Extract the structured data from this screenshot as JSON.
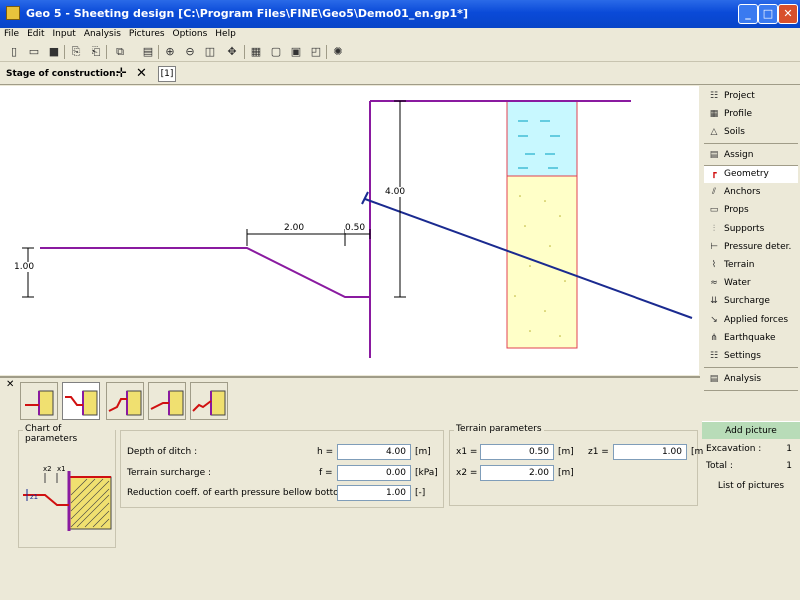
{
  "window": {
    "title": "Geo 5 - Sheeting design [C:\\Program Files\\FINE\\Geo5\\Demo01_en.gp1*]",
    "min": "_",
    "max": "□",
    "close": "✕"
  },
  "menu": [
    "File",
    "Edit",
    "Input",
    "Analysis",
    "Pictures",
    "Options",
    "Help"
  ],
  "stage": {
    "label": "Stage of construction:",
    "current": "[1]"
  },
  "canvas": {
    "dim_depth": "1.00",
    "dim_x2": "2.00",
    "dim_x1": "0.50",
    "dim_h": "4.00"
  },
  "sidebar": {
    "items": [
      {
        "label": "Project",
        "icon": "project-icon"
      },
      {
        "label": "Profile",
        "icon": "profile-icon"
      },
      {
        "label": "Soils",
        "icon": "soils-icon"
      },
      {
        "label": "Assign",
        "icon": "assign-icon"
      },
      {
        "label": "Geometry",
        "icon": "geometry-icon"
      },
      {
        "label": "Anchors",
        "icon": "anchors-icon"
      },
      {
        "label": "Props",
        "icon": "props-icon"
      },
      {
        "label": "Supports",
        "icon": "supports-icon"
      },
      {
        "label": "Pressure deter.",
        "icon": "pressure-icon"
      },
      {
        "label": "Terrain",
        "icon": "terrain-icon"
      },
      {
        "label": "Water",
        "icon": "water-icon"
      },
      {
        "label": "Surcharge",
        "icon": "surcharge-icon"
      },
      {
        "label": "Applied forces",
        "icon": "forces-icon"
      },
      {
        "label": "Earthquake",
        "icon": "earthquake-icon"
      },
      {
        "label": "Settings",
        "icon": "settings-icon"
      },
      {
        "label": "Analysis",
        "icon": "analysis-icon"
      }
    ],
    "selected": "Geometry",
    "add_picture": "Add picture",
    "excavation_label": "Excavation :",
    "excavation_count": "1",
    "total_label": "Total :",
    "total_count": "1",
    "list_pictures": "List of pictures"
  },
  "panel": {
    "chart_caption": "Chart of parameters",
    "chart_x2": "x2",
    "chart_x1": "x1",
    "chart_z1": "z1",
    "fields": {
      "depth_label": "Depth of ditch :",
      "depth_sym": "h =",
      "depth_val": "4.00",
      "depth_unit": "[m]",
      "surch_label": "Terrain surcharge :",
      "surch_sym": "f =",
      "surch_val": "0.00",
      "surch_unit": "[kPa]",
      "red_label": "Reduction coeff. of earth pressure bellow bottom :",
      "red_val": "1.00",
      "red_unit": "[-]"
    },
    "terrain": {
      "caption": "Terrain parameters",
      "x1_sym": "x1 =",
      "x1_val": "0.50",
      "x1_unit": "[m]",
      "z1_sym": "z1 =",
      "z1_val": "1.00",
      "z1_unit": "[m",
      "x2_sym": "x2 =",
      "x2_val": "2.00",
      "x2_unit": "[m]"
    }
  },
  "colors": {
    "sheet": "#8a1aa0",
    "water_line": "#1a2a90",
    "soil_fill": "#ffffc8",
    "water_fill": "#c8f8ff",
    "soil_border": "#e04050"
  }
}
